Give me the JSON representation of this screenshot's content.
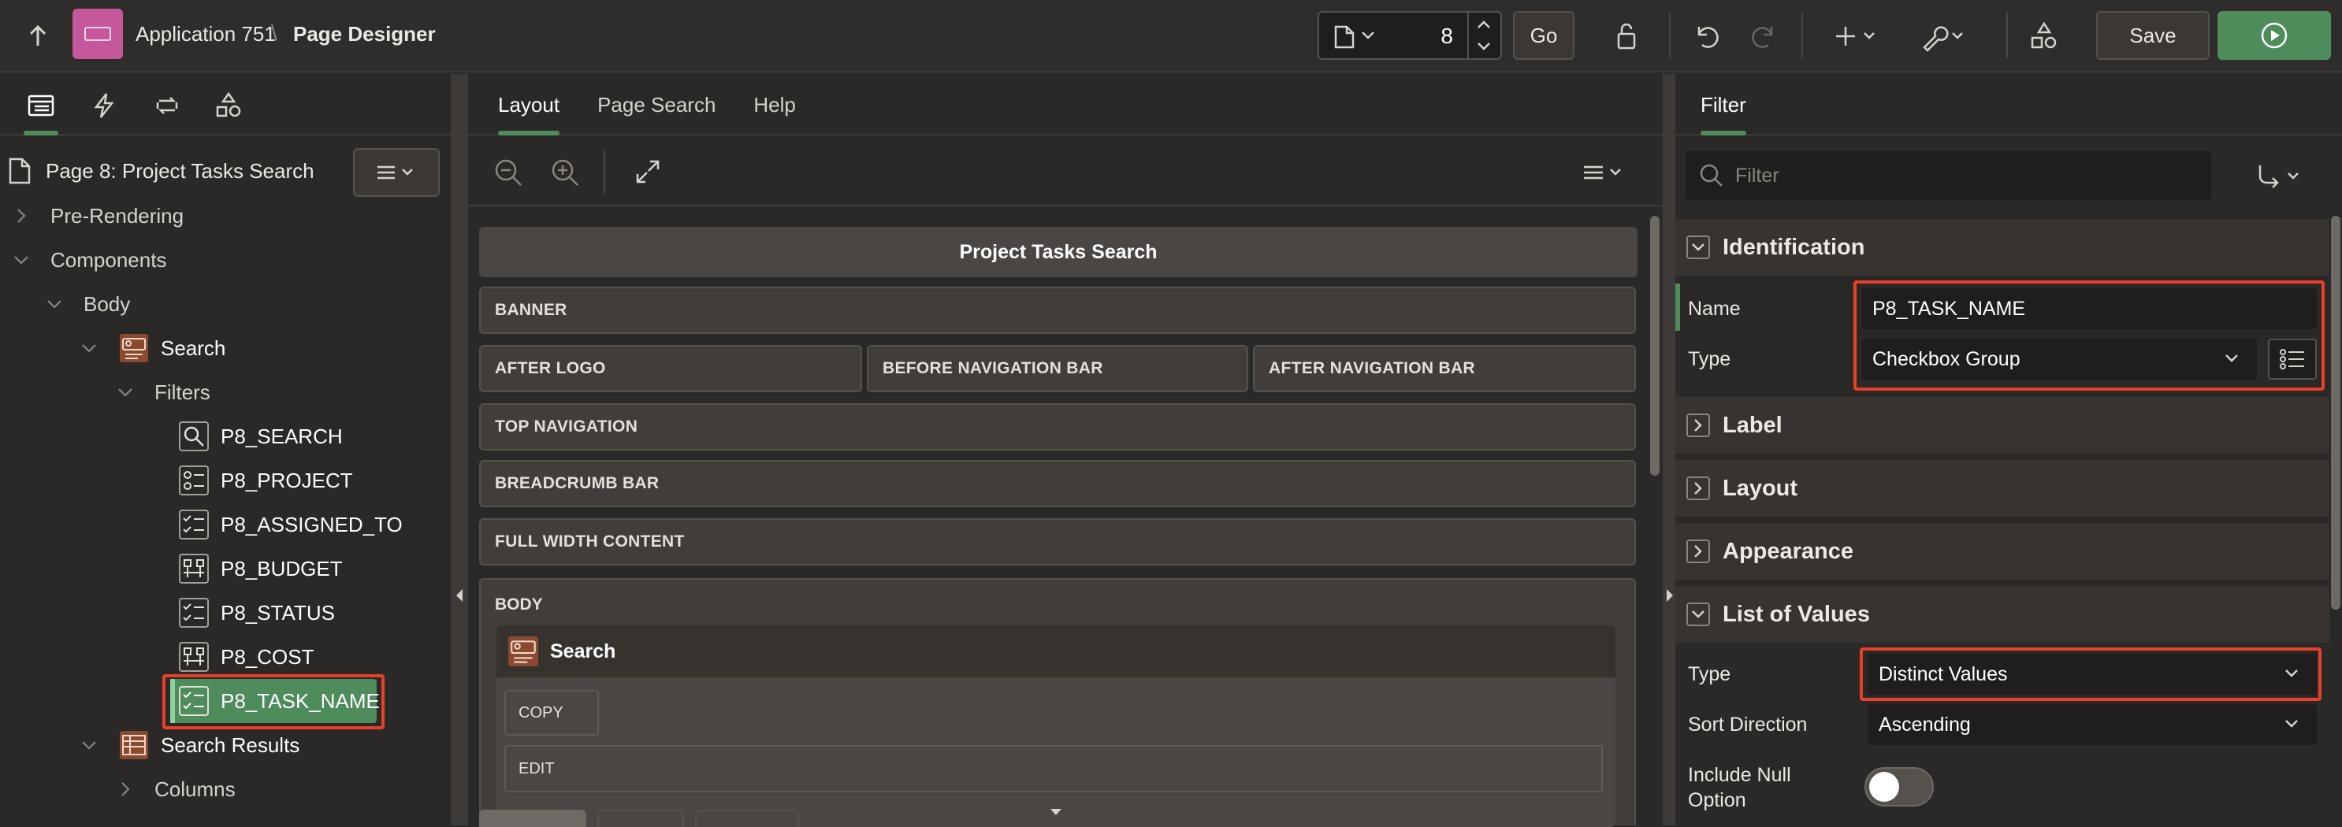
{
  "header": {
    "app_name": "Application 751",
    "separator": "\\",
    "page_title": "Page Designer",
    "page_number": "8",
    "go_label": "Go",
    "save_label": "Save"
  },
  "left": {
    "page_label": "Page 8: Project Tasks Search",
    "tree": [
      {
        "label": "Pre-Rendering"
      },
      {
        "label": "Components"
      },
      {
        "label": "Body"
      },
      {
        "label": "Search"
      },
      {
        "label": "Filters"
      },
      {
        "label": "P8_SEARCH"
      },
      {
        "label": "P8_PROJECT"
      },
      {
        "label": "P8_ASSIGNED_TO"
      },
      {
        "label": "P8_BUDGET"
      },
      {
        "label": "P8_STATUS"
      },
      {
        "label": "P8_COST"
      },
      {
        "label": "P8_TASK_NAME"
      },
      {
        "label": "Search Results"
      },
      {
        "label": "Columns"
      }
    ]
  },
  "center": {
    "tabs": [
      "Layout",
      "Page Search",
      "Help"
    ],
    "page_header": "Project Tasks Search",
    "regions": {
      "banner": "BANNER",
      "after_logo": "AFTER LOGO",
      "before_nav": "BEFORE NAVIGATION BAR",
      "after_nav": "AFTER NAVIGATION BAR",
      "top_nav": "TOP NAVIGATION",
      "breadcrumb": "BREADCRUMB BAR",
      "full_width": "FULL WIDTH CONTENT",
      "body": "BODY"
    },
    "search_region": "Search",
    "copy": "COPY",
    "edit": "EDIT"
  },
  "right": {
    "tab": "Filter",
    "filter_placeholder": "Filter",
    "sections": {
      "identification": "Identification",
      "label": "Label",
      "layout": "Layout",
      "appearance": "Appearance",
      "lov": "List of Values"
    },
    "name_label": "Name",
    "name_value": "P8_TASK_NAME",
    "type_label": "Type",
    "type_value": "Checkbox Group",
    "lov_type_label": "Type",
    "lov_type_value": "Distinct Values",
    "sort_label": "Sort Direction",
    "sort_value": "Ascending",
    "null_label_1": "Include Null",
    "null_label_2": "Option"
  },
  "colors": {
    "accent_green": "#4e8c5c",
    "highlight_red": "#e8402a",
    "app_icon": "#c5579b"
  }
}
